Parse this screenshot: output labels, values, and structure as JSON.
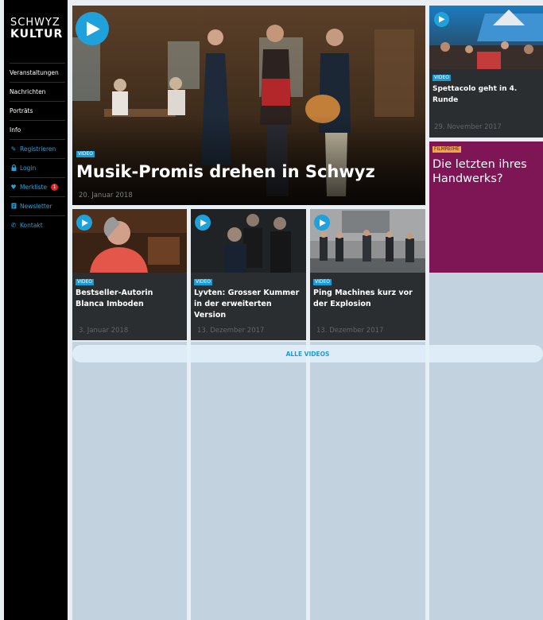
{
  "brand": {
    "logo_top": "SCHWYZ",
    "logo_bottom": "KULTUR"
  },
  "sidebar": {
    "items": [
      {
        "label": "Veranstaltungen"
      },
      {
        "label": "Nachrichten"
      },
      {
        "label": "Porträts"
      },
      {
        "label": "Info"
      }
    ],
    "actions": [
      {
        "label": "Registrieren",
        "icon": "pencil-icon"
      },
      {
        "label": "Login",
        "icon": "lock-icon"
      },
      {
        "label": "Merkliste",
        "icon": "heart-icon",
        "badge": "1"
      },
      {
        "label": "Newsletter",
        "icon": "newsletter-icon"
      },
      {
        "label": "Kontakt",
        "icon": "phone-icon"
      }
    ]
  },
  "hero": {
    "tag": "VIDEO",
    "title": "Musik-Promis drehen in Schwyz",
    "date": "20. Januar 2018"
  },
  "side_cards": [
    {
      "tag": "VIDEO",
      "title": "Spettacolo geht in 4. Runde",
      "date": "29. November 2017"
    },
    {
      "tag": "FILMREIHE",
      "title": "Die letzten ihres Handwerks?"
    }
  ],
  "video_cards": [
    {
      "tag": "VIDEO",
      "title": "Bestseller-Autorin Blanca Imboden",
      "date": "3. Januar 2018"
    },
    {
      "tag": "VIDEO",
      "title": "Lyvten: Grosser Kummer in der erweiterten Version",
      "date": "13. Dezember 2017"
    },
    {
      "tag": "VIDEO",
      "title": "Ping Machines kurz vor der Explosion",
      "date": "13. Dezember 2017"
    }
  ],
  "all_videos_label": "ALLE VIDEOS",
  "colors": {
    "accent": "#1fa2dc",
    "film_bg": "#7e1656",
    "film_tag": "#f0a83c",
    "badge": "#e4222b"
  }
}
